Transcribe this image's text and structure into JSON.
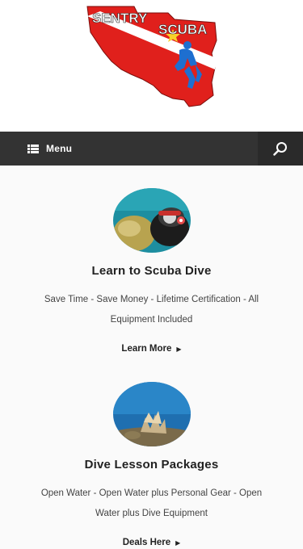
{
  "logo": {
    "word_top": "SENTRY",
    "word_bottom": "SCUBA"
  },
  "nav": {
    "menu_icon": "list-icon",
    "menu_label": "Menu",
    "search_icon": "search-icon"
  },
  "sections": [
    {
      "image": "scuba-diver-photo",
      "title": "Learn to Scuba Dive",
      "description": "Save Time - Save Money - Lifetime Certification - All Equipment Included",
      "cta": "Learn More",
      "cta_icon": "triangle-right-icon"
    },
    {
      "image": "coral-reef-photo",
      "title": "Dive Lesson Packages",
      "description": "Open Water - Open Water plus Personal Gear - Open Water plus Dive Equipment",
      "cta": "Deals Here",
      "cta_icon": "triangle-right-icon"
    }
  ],
  "colors": {
    "navbar": "#333333",
    "search_bg": "#2a2a2a",
    "logo_red": "#e0201c",
    "logo_stripe": "#ffffff",
    "logo_blue": "#1e6fd0",
    "page_bg": "#fafafa"
  }
}
